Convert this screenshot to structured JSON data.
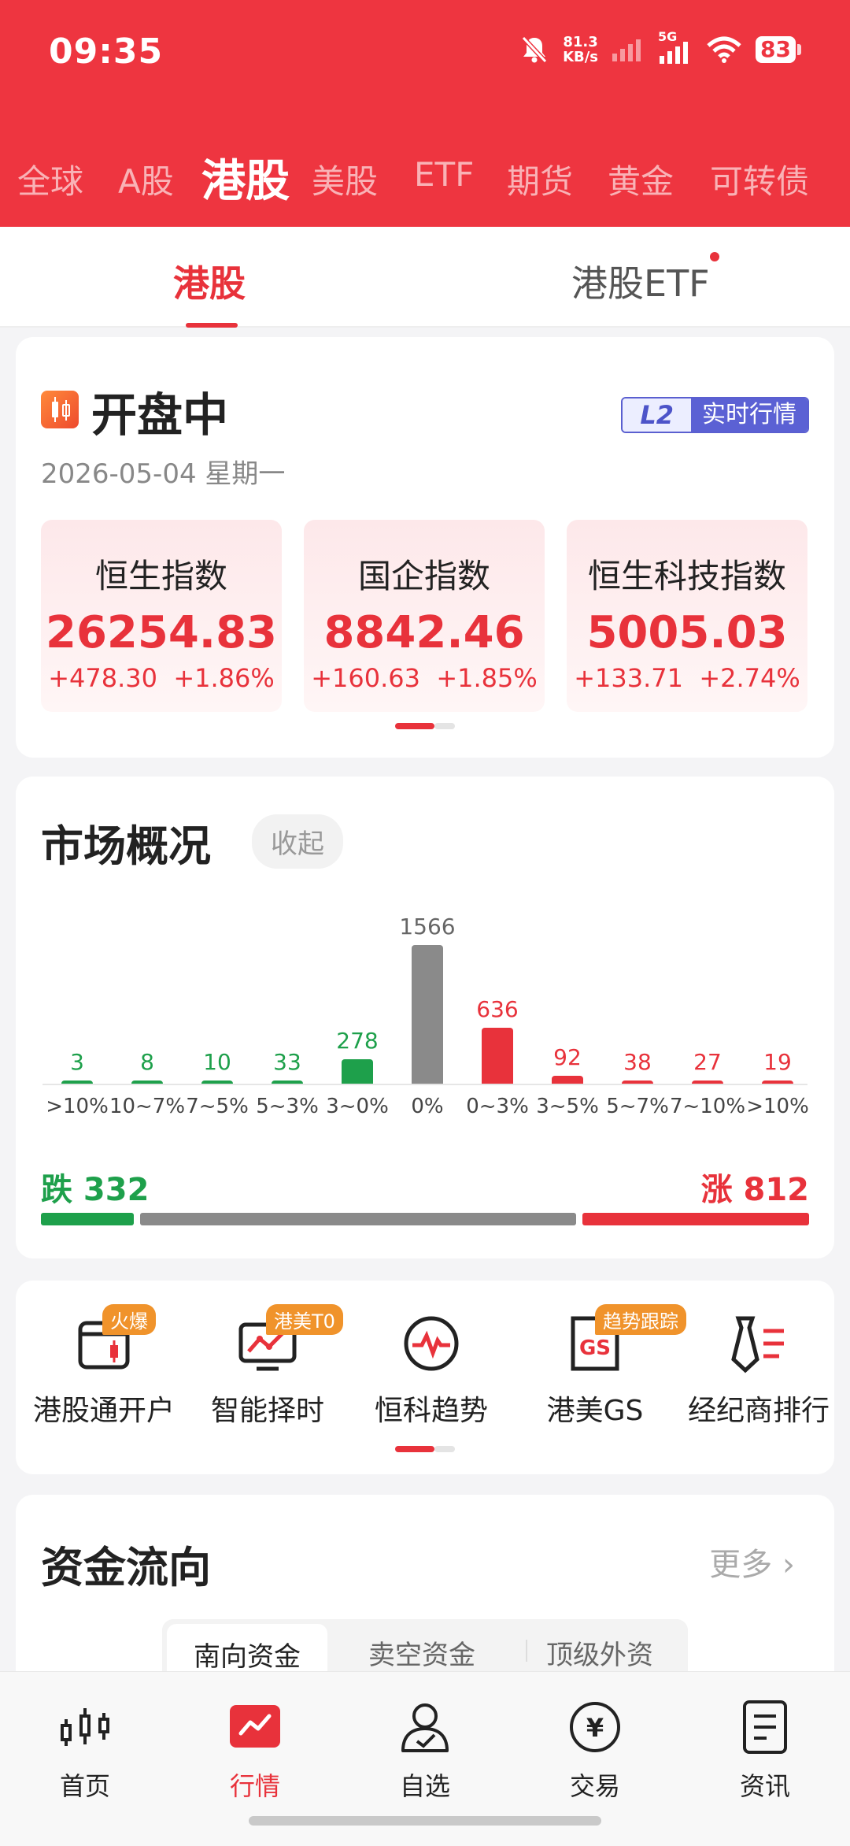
{
  "status": {
    "time": "09:35",
    "speed_value": "81.3",
    "speed_unit": "KB/s",
    "network": "5G",
    "battery": "83"
  },
  "market_tabs": [
    {
      "label": "全球",
      "active": false
    },
    {
      "label": "A股",
      "active": false
    },
    {
      "label": "港股",
      "active": true
    },
    {
      "label": "美股",
      "active": false
    },
    {
      "label": "ETF",
      "active": false
    },
    {
      "label": "期货",
      "active": false
    },
    {
      "label": "黄金",
      "active": false
    },
    {
      "label": "可转债",
      "active": false
    }
  ],
  "sub_tabs": [
    {
      "label": "港股",
      "active": true
    },
    {
      "label": "港股ETF",
      "active": false
    }
  ],
  "session": {
    "title": "开盘中",
    "date": "2026-05-04 星期一",
    "l2_badge": "L2",
    "l2_label": "实时行情"
  },
  "indices": [
    {
      "name": "恒生指数",
      "value": "26254.83",
      "change": "+478.30",
      "pct": "+1.86%"
    },
    {
      "name": "国企指数",
      "value": "8842.46",
      "change": "+160.63",
      "pct": "+1.85%"
    },
    {
      "name": "恒生科技指数",
      "value": "5005.03",
      "change": "+133.71",
      "pct": "+2.74%"
    }
  ],
  "overview": {
    "title": "市场概况",
    "collapse_label": "收起",
    "fall_label": "跌 332",
    "rise_label": "涨 812",
    "fall_count": 332,
    "flat_count": 1566,
    "rise_count": 812
  },
  "colors": {
    "red": "#e8323b",
    "green": "#1ea04b",
    "gray": "#8a8a8a",
    "header": "#ee3540"
  },
  "chart_data": {
    "type": "bar",
    "categories": [
      ">10%",
      "10~7%",
      "7~5%",
      "5~3%",
      "3~0%",
      "0%",
      "0~3%",
      "3~5%",
      "5~7%",
      "7~10%",
      ">10%"
    ],
    "values": [
      3,
      8,
      10,
      33,
      278,
      1566,
      636,
      92,
      38,
      27,
      19
    ],
    "groups": [
      "down",
      "down",
      "down",
      "down",
      "down",
      "flat",
      "up",
      "up",
      "up",
      "up",
      "up"
    ],
    "title": "",
    "xlabel": "",
    "ylabel": "",
    "grid": false
  },
  "quick_actions": [
    {
      "label": "港股通开户",
      "badge": "火爆",
      "icon": "calendar-candle-icon"
    },
    {
      "label": "智能择时",
      "badge": "港美T0",
      "icon": "monitor-chart-icon"
    },
    {
      "label": "恒科趋势",
      "badge": "",
      "icon": "pulse-circle-icon"
    },
    {
      "label": "港美GS",
      "badge": "趋势跟踪",
      "icon": "gs-doc-icon"
    },
    {
      "label": "经纪商排行",
      "badge": "",
      "icon": "tie-list-icon"
    }
  ],
  "fund_flow": {
    "title": "资金流向",
    "more_label": "更多",
    "tabs": [
      {
        "label": "南向资金",
        "active": true
      },
      {
        "label": "卖空资金",
        "active": false
      },
      {
        "label": "顶级外资",
        "active": false
      }
    ]
  },
  "bottom_nav": [
    {
      "label": "首页",
      "icon": "candlestick-icon",
      "active": false
    },
    {
      "label": "行情",
      "icon": "trend-chart-icon",
      "active": true
    },
    {
      "label": "自选",
      "icon": "user-check-icon",
      "active": false
    },
    {
      "label": "交易",
      "icon": "yen-circle-icon",
      "active": false
    },
    {
      "label": "资讯",
      "icon": "document-icon",
      "active": false
    }
  ]
}
